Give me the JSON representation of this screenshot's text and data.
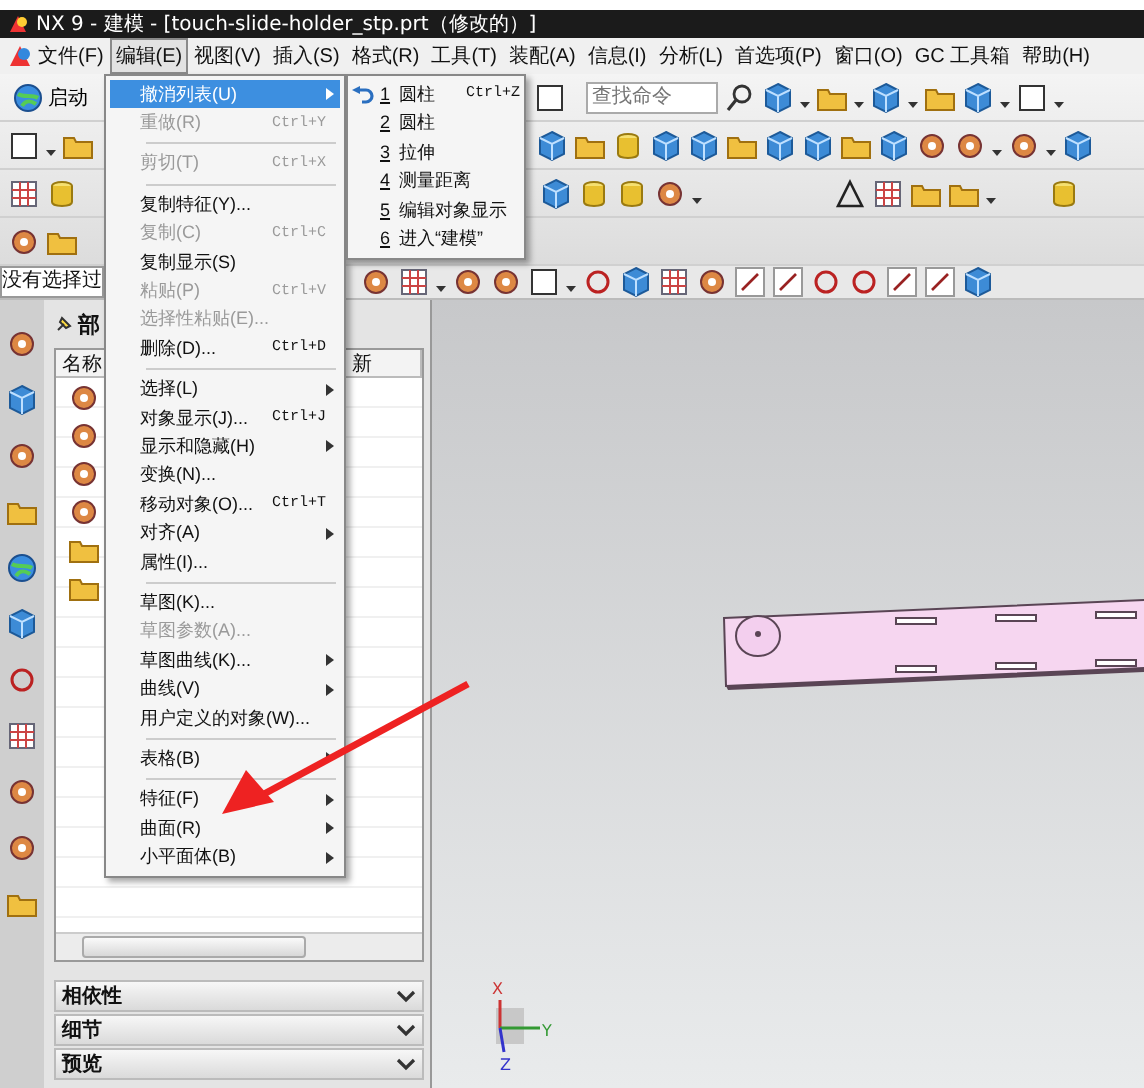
{
  "window": {
    "title": "NX 9 - 建模 - [touch-slide-holder_stp.prt（修改的）]"
  },
  "menu_bar": [
    {
      "label": "文件(F)",
      "selected": false
    },
    {
      "label": "编辑(E)",
      "selected": true
    },
    {
      "label": "视图(V)",
      "selected": false
    },
    {
      "label": "插入(S)",
      "selected": false
    },
    {
      "label": "格式(R)",
      "selected": false
    },
    {
      "label": "工具(T)",
      "selected": false
    },
    {
      "label": "装配(A)",
      "selected": false
    },
    {
      "label": "信息(I)",
      "selected": false
    },
    {
      "label": "分析(L)",
      "selected": false
    },
    {
      "label": "首选项(P)",
      "selected": false
    },
    {
      "label": "窗口(O)",
      "selected": false
    },
    {
      "label": "GC 工具箱",
      "selected": false
    },
    {
      "label": "帮助(H)",
      "selected": false
    }
  ],
  "toolbar": {
    "start_button": "启动",
    "search": {
      "placeholder": "查找命令"
    }
  },
  "selection_bar": {
    "filter": "没有选择过"
  },
  "navigator": {
    "title": "部",
    "columns": [
      "名称",
      "新"
    ],
    "sections": [
      {
        "label": "相依性",
        "expanded": false
      },
      {
        "label": "细节",
        "expanded": false
      },
      {
        "label": "预览",
        "expanded": false
      }
    ]
  },
  "edit_menu": [
    {
      "kind": "item",
      "label": "撤消列表(U)",
      "submenu": true,
      "disabled": false,
      "selected": true
    },
    {
      "kind": "item",
      "label": "重做(R)",
      "shortcut": "Ctrl+Y",
      "submenu": false,
      "disabled": true,
      "selected": false
    },
    {
      "kind": "separator"
    },
    {
      "kind": "item",
      "label": "剪切(T)",
      "shortcut": "Ctrl+X",
      "submenu": false,
      "disabled": true,
      "selected": false
    },
    {
      "kind": "separator"
    },
    {
      "kind": "item",
      "label": "复制特征(Y)...",
      "submenu": false,
      "disabled": false,
      "selected": false
    },
    {
      "kind": "item",
      "label": "复制(C)",
      "shortcut": "Ctrl+C",
      "submenu": false,
      "disabled": true,
      "selected": false
    },
    {
      "kind": "item",
      "label": "复制显示(S)",
      "submenu": false,
      "disabled": false,
      "selected": false
    },
    {
      "kind": "item",
      "label": "粘贴(P)",
      "shortcut": "Ctrl+V",
      "submenu": false,
      "disabled": true,
      "selected": false
    },
    {
      "kind": "item",
      "label": "选择性粘贴(E)...",
      "submenu": false,
      "disabled": true,
      "selected": false
    },
    {
      "kind": "item",
      "label": "删除(D)...",
      "shortcut": "Ctrl+D",
      "submenu": false,
      "disabled": false,
      "selected": false
    },
    {
      "kind": "separator"
    },
    {
      "kind": "item",
      "label": "选择(L)",
      "submenu": true,
      "disabled": false,
      "selected": false
    },
    {
      "kind": "item",
      "label": "对象显示(J)...",
      "shortcut": "Ctrl+J",
      "submenu": false,
      "disabled": false,
      "selected": false
    },
    {
      "kind": "item",
      "label": "显示和隐藏(H)",
      "submenu": true,
      "disabled": false,
      "selected": false
    },
    {
      "kind": "item",
      "label": "变换(N)...",
      "submenu": false,
      "disabled": false,
      "selected": false
    },
    {
      "kind": "item",
      "label": "移动对象(O)...",
      "shortcut": "Ctrl+T",
      "submenu": false,
      "disabled": false,
      "selected": false
    },
    {
      "kind": "item",
      "label": "对齐(A)",
      "submenu": true,
      "disabled": false,
      "selected": false
    },
    {
      "kind": "item",
      "label": "属性(I)...",
      "submenu": false,
      "disabled": false,
      "selected": false
    },
    {
      "kind": "separator"
    },
    {
      "kind": "item",
      "label": "草图(K)...",
      "submenu": false,
      "disabled": false,
      "selected": false
    },
    {
      "kind": "item",
      "label": "草图参数(A)...",
      "submenu": false,
      "disabled": true,
      "selected": false
    },
    {
      "kind": "item",
      "label": "草图曲线(K)...",
      "submenu": true,
      "disabled": false,
      "selected": false
    },
    {
      "kind": "item",
      "label": "曲线(V)",
      "submenu": true,
      "disabled": false,
      "selected": false
    },
    {
      "kind": "item",
      "label": "用户定义的对象(W)...",
      "submenu": false,
      "disabled": false,
      "selected": false
    },
    {
      "kind": "separator"
    },
    {
      "kind": "item",
      "label": "表格(B)",
      "submenu": true,
      "disabled": false,
      "selected": false
    },
    {
      "kind": "separator"
    },
    {
      "kind": "item",
      "label": "特征(F)",
      "submenu": true,
      "disabled": false,
      "selected": false
    },
    {
      "kind": "item",
      "label": "曲面(R)",
      "submenu": true,
      "disabled": false,
      "selected": false
    },
    {
      "kind": "item",
      "label": "小平面体(B)",
      "submenu": true,
      "disabled": false,
      "selected": false
    }
  ],
  "undo_list": [
    {
      "number": "1",
      "label": "圆柱",
      "shortcut": "Ctrl+Z"
    },
    {
      "number": "2",
      "label": "圆柱"
    },
    {
      "number": "3",
      "label": "拉伸"
    },
    {
      "number": "4",
      "label": "测量距离"
    },
    {
      "number": "5",
      "label": "编辑对象显示"
    },
    {
      "number": "6",
      "label": "进入“建模”"
    }
  ],
  "viewport": {
    "axis_triad": {
      "x": "X",
      "y": "Y",
      "z": "Z"
    }
  }
}
